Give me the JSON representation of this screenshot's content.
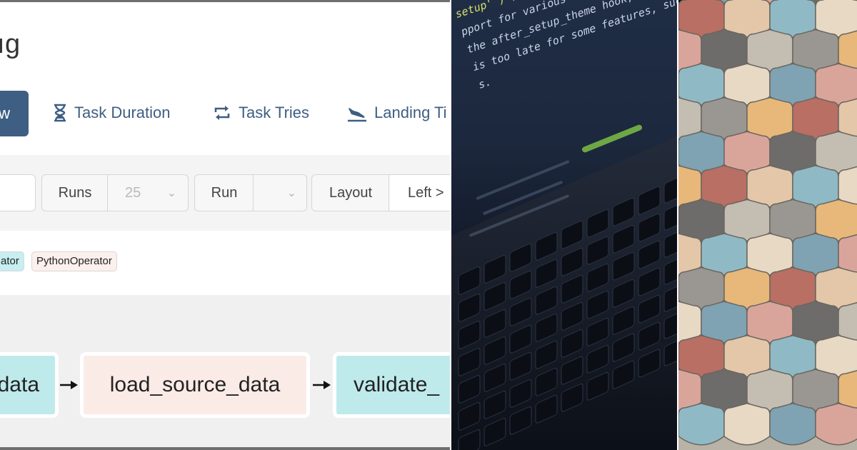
{
  "ui": {
    "title_fragment": "ıg",
    "active_view_fragment": "w",
    "nav_links": [
      {
        "label": "Task Duration",
        "icon": "hourglass-icon"
      },
      {
        "label": "Task Tries",
        "icon": "repeat-icon"
      },
      {
        "label": "Landing Ti",
        "icon": "plane-landing-icon"
      }
    ],
    "controls": {
      "runs_label": "Runs",
      "runs_value": "25",
      "run_label": "Run",
      "run_value": "",
      "layout_label": "Layout",
      "layout_value": "Left >"
    },
    "tags": [
      {
        "label": "ator",
        "bg": "#c7eef0"
      },
      {
        "label": "PythonOperator",
        "bg": "#fbf0ec"
      }
    ],
    "nodes": [
      {
        "label": "data",
        "color": "#bfeaec"
      },
      {
        "label": "load_source_data",
        "color": "#fbebe6"
      },
      {
        "label": "validate_",
        "color": "#bfeaec"
      }
    ]
  },
  "photos": {
    "laptop_code_lines": [
      "setup' ) ) ;",
      "pport for various WordPress featu",
      "the after_setup_theme hook, which",
      "is too late for some features, such",
      "s."
    ],
    "tile_colors": [
      "#8fbac5",
      "#d9a59b",
      "#9a9792",
      "#e3c7a8",
      "#7fa3b3",
      "#c4bdb2",
      "#b96f63",
      "#e8d9c4",
      "#6e6c6a",
      "#e7b87a"
    ]
  }
}
